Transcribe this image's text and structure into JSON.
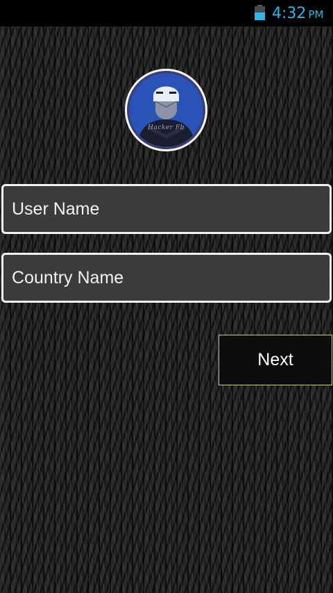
{
  "status_bar": {
    "time": "4:32",
    "ampm": "PM",
    "battery_icon": "battery-icon",
    "accent_color": "#33b5e5"
  },
  "avatar": {
    "caption": "Hacker Fb",
    "icon": "hacker-avatar-icon",
    "ring_color": "#2a53b8"
  },
  "form": {
    "user_name_placeholder": "User Name",
    "country_name_placeholder": "Country Name",
    "next_label": "Next"
  }
}
